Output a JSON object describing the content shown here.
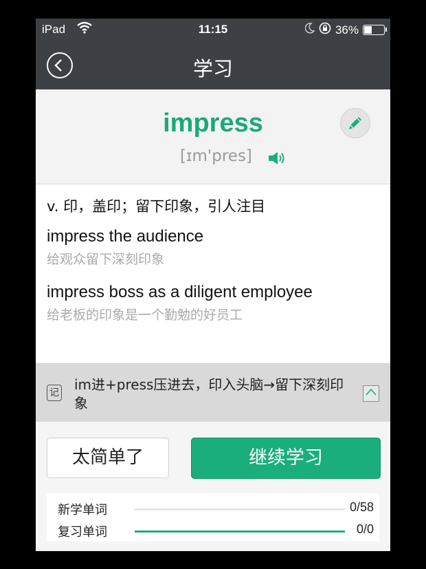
{
  "status_bar": {
    "carrier": "iPad",
    "time": "11:15",
    "battery": "36%",
    "battery_level": 0.36
  },
  "nav": {
    "title": "学习"
  },
  "word": {
    "text": "impress",
    "phonetic": "[ɪm'pres]"
  },
  "definition": {
    "pos_meaning": "v. 印，盖印；留下印象，引人注目"
  },
  "examples": [
    {
      "en": "impress the audience",
      "cn": "给观众留下深刻印象"
    },
    {
      "en": "impress boss as a diligent employee",
      "cn": "给老板的印象是一个勤勉的好员工"
    }
  ],
  "memo": {
    "icon_text": "记",
    "text": "im进+press压进去，印入头脑→留下深刻印象"
  },
  "actions": {
    "too_easy": "太简单了",
    "continue": "继续学习"
  },
  "progress": [
    {
      "label": "新学单词",
      "count": "0/58",
      "fraction": 0
    },
    {
      "label": "复习单词",
      "count": "0/0",
      "fraction": 1
    }
  ],
  "colors": {
    "accent": "#1aae7c",
    "nav_bg": "#3d4044"
  }
}
